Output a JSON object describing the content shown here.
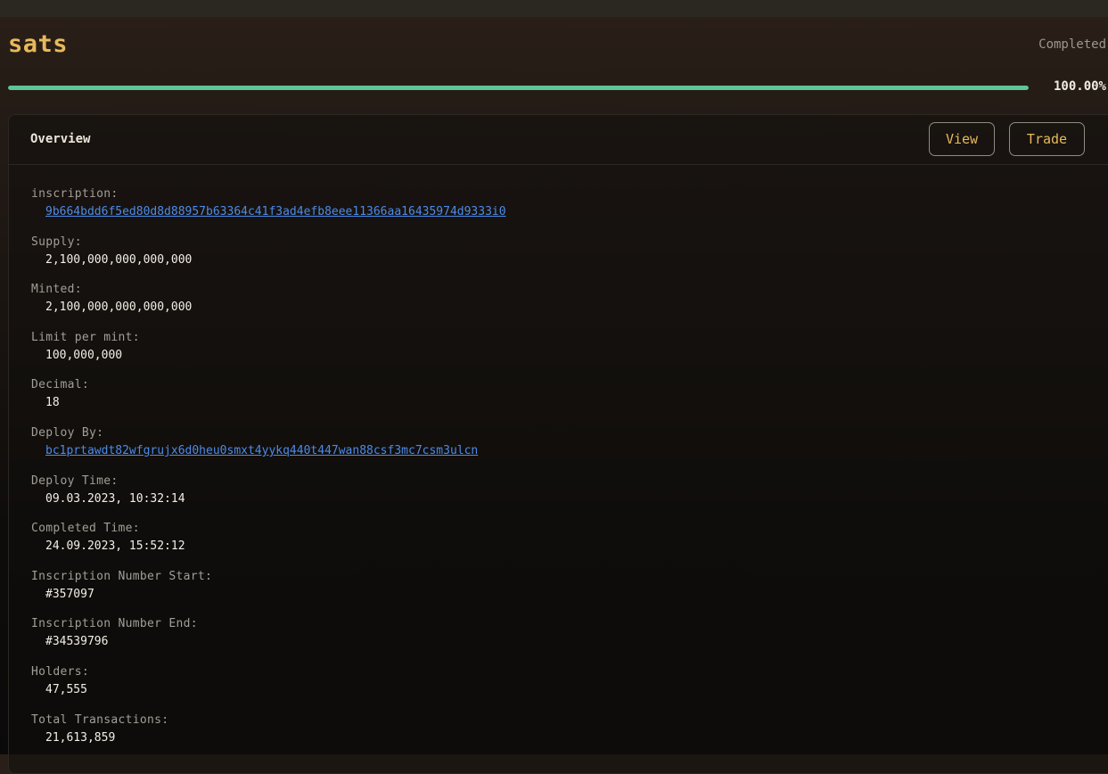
{
  "token": {
    "name": "sats",
    "status": "Completed",
    "progress_percent": 100,
    "progress_label": "100.00%"
  },
  "overview": {
    "title": "Overview",
    "buttons": {
      "view_label": "View",
      "trade_label": "Trade"
    },
    "fields": [
      {
        "label": "inscription:",
        "value": "9b664bdd6f5ed80d8d88957b63364c41f3ad4efb8eee11366aa16435974d9333i0",
        "link": true
      },
      {
        "label": "Supply:",
        "value": "2,100,000,000,000,000",
        "link": false
      },
      {
        "label": "Minted:",
        "value": "2,100,000,000,000,000",
        "link": false
      },
      {
        "label": "Limit per mint:",
        "value": "100,000,000",
        "link": false
      },
      {
        "label": "Decimal:",
        "value": "18",
        "link": false
      },
      {
        "label": "Deploy By:",
        "value": "bc1prtawdt82wfgrujx6d0heu0smxt4yykq440t447wan88csf3mc7csm3ulcn",
        "link": true
      },
      {
        "label": "Deploy Time:",
        "value": "09.03.2023, 10:32:14",
        "link": false
      },
      {
        "label": "Completed Time:",
        "value": "24.09.2023, 15:52:12",
        "link": false
      },
      {
        "label": "Inscription Number Start:",
        "value": "#357097",
        "link": false
      },
      {
        "label": "Inscription Number End:",
        "value": "#34539796",
        "link": false
      },
      {
        "label": "Holders:",
        "value": "47,555",
        "link": false
      },
      {
        "label": "Total Transactions:",
        "value": "21,613,859",
        "link": false
      }
    ]
  },
  "colors": {
    "accent": "#e7b95b",
    "progress": "#5fc598",
    "link": "#4d8be8"
  }
}
